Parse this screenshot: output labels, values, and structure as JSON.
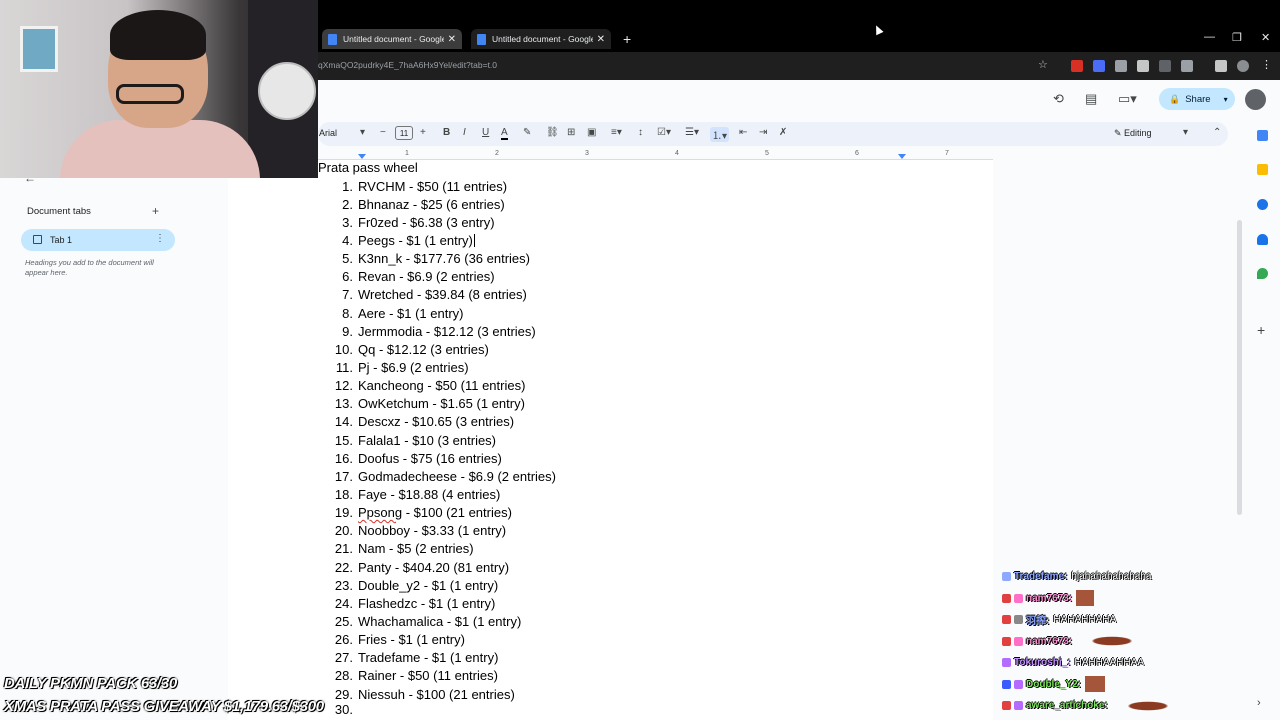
{
  "browser": {
    "tabs": [
      {
        "label": "Untitled document - Google Do"
      },
      {
        "label": "Untitled document - Google Do"
      }
    ],
    "url": "qXmaQO2pudrky4E_7haA6Hx9Yel/edit?tab=t.0"
  },
  "header": {
    "share_label": "Share"
  },
  "toolbar": {
    "font": "Arial",
    "font_size": "11",
    "mode": "Editing"
  },
  "ruler": [
    "1",
    "2",
    "3",
    "4",
    "5",
    "6",
    "7"
  ],
  "sidebar": {
    "title": "Document tabs",
    "tab_label": "Tab 1",
    "hint": "Headings you add to the document will appear here."
  },
  "document": {
    "title": "Prata pass wheel",
    "entries": [
      {
        "num": "1.",
        "text": "RVCHM - $50 (11 entries)"
      },
      {
        "num": "2.",
        "text": "Bhnanaz - $25 (6 entries)"
      },
      {
        "num": "3.",
        "text": "Fr0zed - $6.38 (3 entry)"
      },
      {
        "num": "4.",
        "text": "Peegs - $1 (1 entry)"
      },
      {
        "num": "5.",
        "text": "K3nn_k - $177.76 (36 entries)"
      },
      {
        "num": "6.",
        "text": "Revan - $6.9 (2 entries)"
      },
      {
        "num": "7.",
        "text": "Wretched - $39.84 (8 entries)"
      },
      {
        "num": "8.",
        "text": "Aere - $1 (1 entry)"
      },
      {
        "num": "9.",
        "text": "Jermmodia - $12.12 (3 entries)"
      },
      {
        "num": "10.",
        "text": "Qq - $12.12 (3 entries)"
      },
      {
        "num": "11.",
        "text": "Pj - $6.9 (2 entries)"
      },
      {
        "num": "12.",
        "text": "Kancheong - $50 (11 entries)"
      },
      {
        "num": "13.",
        "text": "OwKetchum - $1.65 (1 entry)"
      },
      {
        "num": "14.",
        "text": "Descxz - $10.65 (3 entries)"
      },
      {
        "num": "15.",
        "text": "Falala1 - $10 (3 entries)"
      },
      {
        "num": "16.",
        "text": "Doofus - $75 (16 entries)"
      },
      {
        "num": "17.",
        "text": "Godmadecheese - $6.9 (2 entries)"
      },
      {
        "num": "18.",
        "text": "Faye - $18.88 (4 entries)"
      },
      {
        "num": "19.",
        "text": "Ppsong - $100 (21 entries)"
      },
      {
        "num": "20.",
        "text": "Noobboy - $3.33 (1 entry)"
      },
      {
        "num": "21.",
        "text": "Nam - $5 (2 entries)"
      },
      {
        "num": "22.",
        "text": "Panty - $404.20 (81 entry)"
      },
      {
        "num": "23.",
        "text": "Double_y2 - $1 (1 entry)"
      },
      {
        "num": "24.",
        "text": "Flashedzc - $1 (1 entry)"
      },
      {
        "num": "25.",
        "text": "Whachamalica - $1 (1 entry)"
      },
      {
        "num": "26.",
        "text": "Fries - $1 (1 entry)"
      },
      {
        "num": "27.",
        "text": "Tradefame - $1 (1 entry)"
      },
      {
        "num": "28.",
        "text": "Rainer - $50 (11 entries)"
      },
      {
        "num": "29.",
        "text": "Niessuh - $100 (21 entries)"
      },
      {
        "num": "30.",
        "text": ""
      }
    ]
  },
  "stream_overlay": {
    "line1": "DAILY PKMN PACK 63/30",
    "line2": "XMAS PRATA PASS GIVEAWAY $1,179.63/$300"
  },
  "chat": [
    {
      "user": "Tradefame:",
      "msg": "hjahahahahahaha",
      "color": "#8fa8ff"
    },
    {
      "user": "nam7673:",
      "msg": "",
      "color": "#ff8fd6"
    },
    {
      "user": "羽搾:",
      "msg": "HAHAHHAHA",
      "color": "#8fa8ff"
    },
    {
      "user": "nam7673:",
      "msg": "",
      "color": "#ff8fd6"
    },
    {
      "user": "Tokuroshi_:",
      "msg": "HAHHAAHHAA",
      "color": "#c38fff"
    },
    {
      "user": "Double_Y2:",
      "msg": "",
      "color": "#7be35c"
    },
    {
      "user": "aware_artichoke:",
      "msg": "",
      "color": "#7be35c"
    }
  ]
}
